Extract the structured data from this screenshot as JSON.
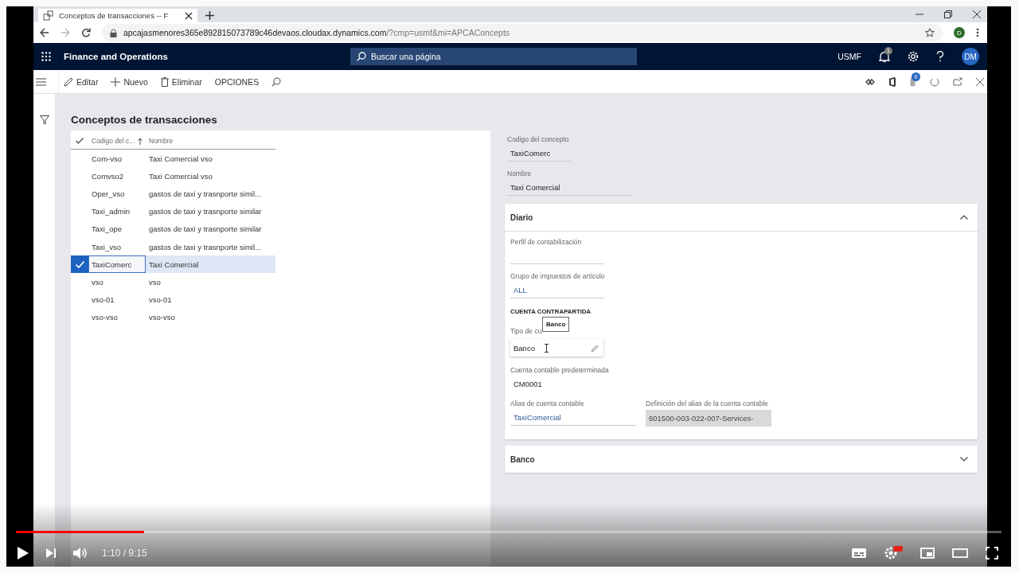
{
  "browser": {
    "tab_title": "Conceptos de transacciones -- F",
    "url_host": "apcajasmenores365e892815073789c46devaos.cloudax.dynamics.com",
    "url_path": "/?cmp=usmf&mi=APCAConcepts",
    "profile": "D"
  },
  "app": {
    "title": "Finance and Operations",
    "search": {
      "placeholder": "Buscar una página"
    },
    "company": "USMF",
    "notifications": "1",
    "user": "DM"
  },
  "actions": [
    {
      "kind": "edit",
      "label": "Editar"
    },
    {
      "kind": "new",
      "label": "Nuevo"
    },
    {
      "kind": "delete",
      "label": "Eliminar"
    },
    {
      "kind": "text",
      "label": "OPCIONES"
    }
  ],
  "messages_count": "0",
  "page_title": "Conceptos de transacciones",
  "grid": {
    "columns": [
      "Codigo del c...",
      "Nombre"
    ],
    "rows": [
      {
        "code": "Com-vso",
        "name": "Taxi Comercial vso",
        "selected": false
      },
      {
        "code": "Comvso2",
        "name": "Taxi Comercial vso",
        "selected": false
      },
      {
        "code": "Oper_vso",
        "name": "gastos de taxi y trasnporte simil...",
        "selected": false
      },
      {
        "code": "Taxi_admin",
        "name": "gastos de taxi y trasnporte similar",
        "selected": false
      },
      {
        "code": "Taxi_ope",
        "name": "gastos de taxi y trasnporte similar",
        "selected": false
      },
      {
        "code": "Taxi_vso",
        "name": "gastos de taxi y trasnporte simil...",
        "selected": false
      },
      {
        "code": "TaxiComerc",
        "name": "Taxi Comercial",
        "selected": true
      },
      {
        "code": "vso",
        "name": "vso",
        "selected": false
      },
      {
        "code": "vso-01",
        "name": "vso-01",
        "selected": false
      },
      {
        "code": "vso-vso",
        "name": "vso-vso",
        "selected": false
      }
    ]
  },
  "header_fields": [
    {
      "label": "Codigo del concepto",
      "value": "TaxiComerc"
    },
    {
      "label": "Nombre",
      "value": "Taxi Comercial"
    }
  ],
  "sections": [
    {
      "title": "Diario",
      "expanded": true
    },
    {
      "title": "Banco",
      "expanded": false
    }
  ],
  "diario": {
    "posting_profile": {
      "label": "Perfil de contabilización"
    },
    "tax_group": {
      "label": "Grupo de impuestos de artículo",
      "value": "ALL"
    },
    "offset_heading": "CUENTA CONTRAPARTIDA",
    "account_type": {
      "label": "Tipo de cu",
      "value": "Banco",
      "tooltip": "Banco"
    },
    "default_account": {
      "label": "Cuenta contable predeterminada",
      "value": "CM0001"
    },
    "alias": {
      "label": "Alias de cuenta contable",
      "value": "TaxiComercial"
    },
    "alias_definition": {
      "label": "Definición del alias de la cuenta contable",
      "value": "601500-003-022-007-Services-"
    }
  },
  "player": {
    "time": "1:10 / 9:15",
    "level": 0.13
  }
}
